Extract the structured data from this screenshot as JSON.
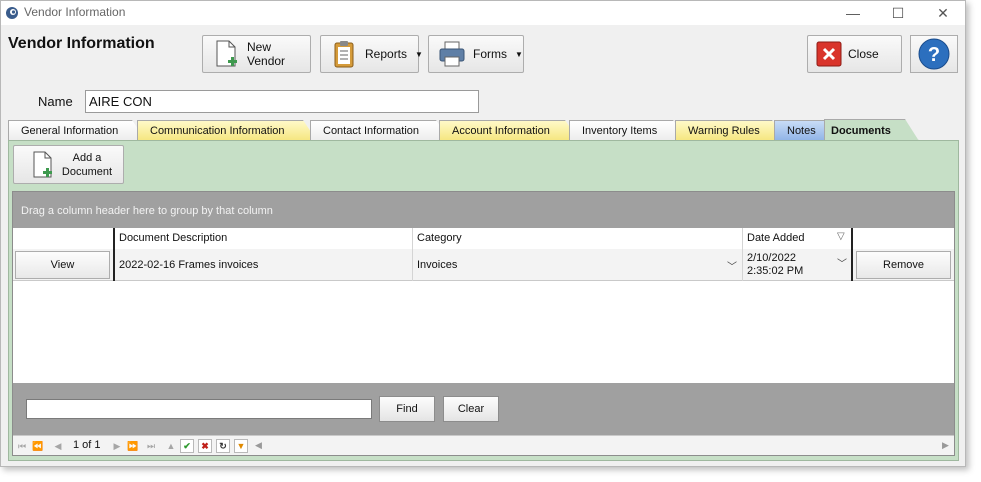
{
  "window": {
    "title": "Vendor Information",
    "minimize": "—",
    "maximize": "☐",
    "close": "✕"
  },
  "header": {
    "title": "Vendor Information"
  },
  "toolbar": {
    "new_vendor": "New Vendor",
    "reports": "Reports",
    "forms": "Forms",
    "close": "Close"
  },
  "name_field": {
    "label": "Name",
    "value": "AIRE CON"
  },
  "tabs": [
    {
      "label": "General Information",
      "style": "white"
    },
    {
      "label": "Communication Information",
      "style": "yellow"
    },
    {
      "label": "Contact Information",
      "style": "white"
    },
    {
      "label": "Account Information",
      "style": "yellow"
    },
    {
      "label": "Inventory Items",
      "style": "white"
    },
    {
      "label": "Warning Rules",
      "style": "yellow"
    },
    {
      "label": "Notes",
      "style": "blue"
    },
    {
      "label": "Documents",
      "style": "active"
    }
  ],
  "documents": {
    "add_button": "Add a\nDocument",
    "group_hint": "Drag a column header here to group by that column",
    "columns": {
      "description": "Document Description",
      "category": "Category",
      "date_added": "Date Added"
    },
    "rows": [
      {
        "view_label": "View",
        "description": "2022-02-16 Frames invoices",
        "category": "Invoices",
        "date_added": "2/10/2022 2:35:02 PM",
        "remove_label": "Remove"
      }
    ],
    "find_button": "Find",
    "clear_button": "Clear",
    "find_value": "",
    "pager": "1 of 1"
  },
  "colors": {
    "tab_body": "#c6dfc6",
    "panel_gray": "#a0a0a0",
    "close_red": "#d9342b",
    "help_blue": "#2c6fbe"
  }
}
